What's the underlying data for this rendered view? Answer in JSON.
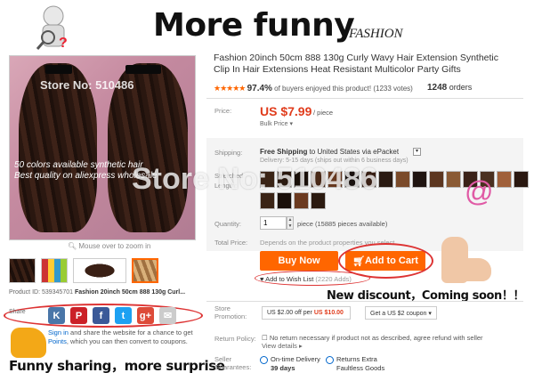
{
  "banner": {
    "title": "More funny",
    "subtitle": "FASHION"
  },
  "gallery": {
    "main_watermark": "Store No: 510486",
    "promo_line1": "50 colors available  synthetic hair",
    "promo_line2": "Best quality on aliexpress  wholesale",
    "zoom_hint": "Mouse over to zoom in",
    "product_id_label": "Product ID: 539345701",
    "product_id_title": "Fashion 20inch 50cm 888 130g Curl..."
  },
  "share": {
    "label": "Share",
    "icons": [
      {
        "name": "vk-icon",
        "glyph": "K",
        "color": "#4a76a8"
      },
      {
        "name": "pinterest-icon",
        "glyph": "P",
        "color": "#cb2027"
      },
      {
        "name": "facebook-icon",
        "glyph": "f",
        "color": "#3b5998"
      },
      {
        "name": "twitter-icon",
        "glyph": "t",
        "color": "#1da1f2"
      },
      {
        "name": "google-plus-icon",
        "glyph": "g+",
        "color": "#dd4b39"
      },
      {
        "name": "email-icon",
        "glyph": "✉",
        "color": "#cccccc"
      }
    ],
    "signin_link": "Sign in",
    "signin_text": " and share the website for a chance to get ",
    "points_link": "Points",
    "points_text": ", which you can then convert to coupons.",
    "caption": "Funny sharing，more surprise"
  },
  "product": {
    "title": "Fashion 20inch 50cm 888 130g Curly Wavy Hair Extension Synthetic Clip In Hair Extensions Heat Resistant Multicolor Party Gifts",
    "stars": "★★★★★",
    "rating_pct": "97.4%",
    "rating_text": " of buyers enjoyed this product! (1233 votes)",
    "orders_count": "1248",
    "orders_label": " orders",
    "price_label": "Price:",
    "price": "US $7.99",
    "per_piece": "/ piece",
    "bulk_price": "Bulk Price ▾",
    "shipping_label": "Shipping:",
    "shipping_bold": "Free Shipping",
    "shipping_text": " to United States via ePacket",
    "shipping_sub": "Delivery: 5-15 days (ships out within 6 business days)",
    "stretched_label": "Stretched",
    "length_label": "Length:",
    "big_watermark": "Store No: 510486",
    "quantity_label": "Quantity:",
    "quantity_value": "1",
    "quantity_text": "piece (15885 pieces available)",
    "total_label": "Total Price:",
    "total_text": "Depends on the product properties you select",
    "buy_now": "Buy Now",
    "add_to_cart": "Add to Cart",
    "wish_label": "Add to Wish List",
    "wish_count": "(2220 Adds)",
    "discount_caption": "New discount，Coming soon！！",
    "promo_label1": "Store",
    "promo_label2": "Promotion:",
    "coupon1_pre": "US $2.00 off per",
    "coupon1_amt": "US $10.00",
    "coupon2": "Get a US $2 coupon ▾",
    "return_label": "Return Policy:",
    "return_text": "No return necessary if product not as described, agree refund with seller",
    "return_link": "View details ▸",
    "seller_label1": "Seller",
    "seller_label2": "Guarantees:",
    "guarantee1_a": "On-time Delivery",
    "guarantee1_b": "39 days",
    "guarantee2_a": "Returns Extra",
    "guarantee2_b": "Faultless Goods"
  },
  "swatch_colors": [
    "#3a2416",
    "#2b1a10",
    "#1a100a",
    "#4a2a18",
    "#6b3a20",
    "#1a1210",
    "#3b2116",
    "#2a1a12",
    "#7a4a2a",
    "#1f1410",
    "#5c3620",
    "#8a5a34",
    "#3a2218",
    "#4a3020",
    "#a0603a",
    "#2a1810"
  ],
  "swatch_colors2": [
    "#3a2416",
    "#1a100a",
    "#6b3a20",
    "#2b1a10"
  ]
}
